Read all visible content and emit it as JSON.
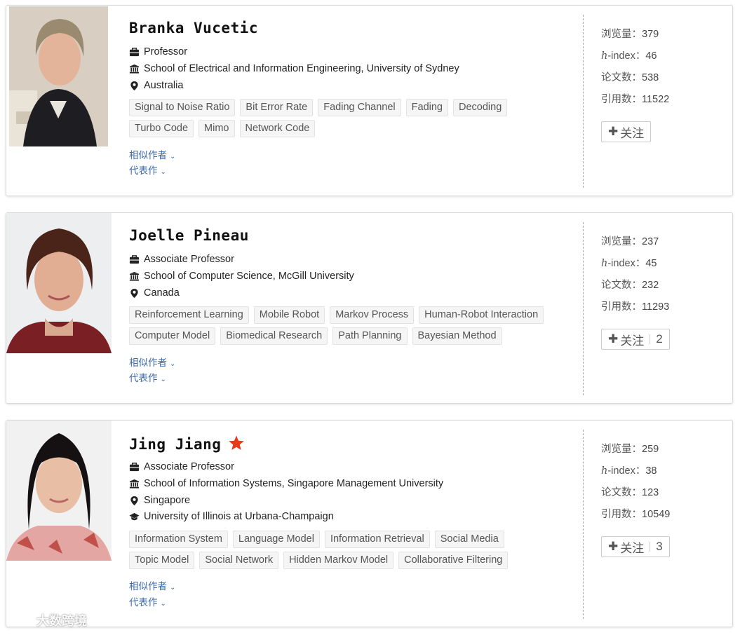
{
  "scholars": [
    {
      "name": "Branka Vucetic",
      "position": "Professor",
      "affiliation": "School of Electrical and Information Engineering, University of Sydney",
      "location": "Australia",
      "tags": [
        "Signal to Noise Ratio",
        "Bit Error Rate",
        "Fading Channel",
        "Fading",
        "Decoding",
        "Turbo Code",
        "Mimo",
        "Network Code"
      ],
      "similar_label": "相似作者",
      "works_label": "代表作",
      "views_label": "浏览量：",
      "views": "379",
      "hindex_label": "-index：",
      "hindex_prefix": "h",
      "hindex": "46",
      "papers_label": "论文数：",
      "papers": "538",
      "citations_label": "引用数：",
      "citations": "11522",
      "follow_label": "关注"
    },
    {
      "name": "Joelle Pineau",
      "position": "Associate Professor",
      "affiliation": "School of Computer Science, McGill University",
      "location": "Canada",
      "tags": [
        "Reinforcement Learning",
        "Mobile Robot",
        "Markov Process",
        "Human-Robot Interaction",
        "Computer Model",
        "Biomedical Research",
        "Path Planning",
        "Bayesian Method"
      ],
      "similar_label": "相似作者",
      "works_label": "代表作",
      "views_label": "浏览量：",
      "views": "237",
      "hindex_label": "-index：",
      "hindex_prefix": "h",
      "hindex": "45",
      "papers_label": "论文数：",
      "papers": "232",
      "citations_label": "引用数：",
      "citations": "11293",
      "follow_label": "关注",
      "follow_count": "2"
    },
    {
      "name": "Jing Jiang",
      "position": "Associate Professor",
      "affiliation": "School of Information Systems, Singapore Management University",
      "location": "Singapore",
      "education": "University of Illinois at Urbana-Champaign",
      "tags": [
        "Information System",
        "Language Model",
        "Information Retrieval",
        "Social Media",
        "Topic Model",
        "Social Network",
        "Hidden Markov Model",
        "Collaborative Filtering"
      ],
      "similar_label": "相似作者",
      "works_label": "代表作",
      "views_label": "浏览量：",
      "views": "259",
      "hindex_label": "-index：",
      "hindex_prefix": "h",
      "hindex": "38",
      "papers_label": "论文数：",
      "papers": "123",
      "citations_label": "引用数：",
      "citations": "10549",
      "follow_label": "关注",
      "follow_count": "3"
    }
  ],
  "watermark": "大数跨境",
  "colors": {
    "link": "#3a6aa8",
    "star": "#e8391d",
    "tag_bg": "#f5f5f5"
  }
}
